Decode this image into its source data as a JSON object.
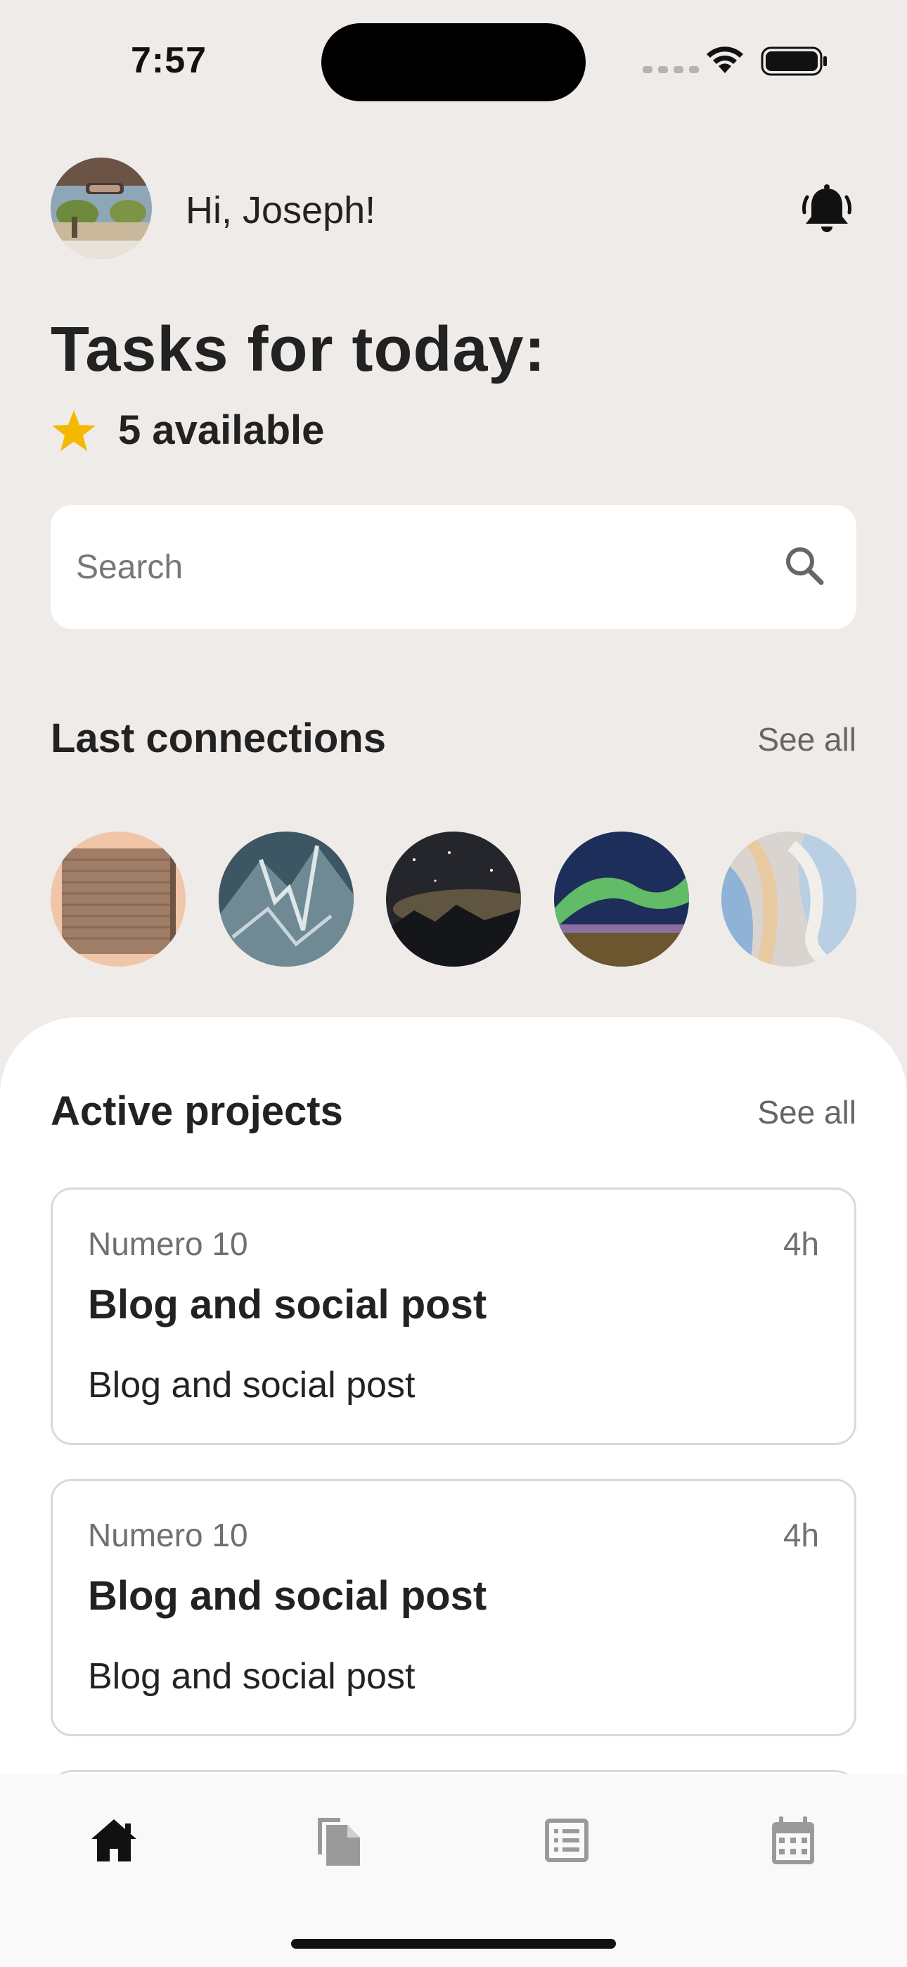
{
  "status_bar": {
    "time": "7:57"
  },
  "header": {
    "greeting": "Hi, Joseph!"
  },
  "tasks": {
    "title": "Tasks for today:",
    "available": "5 available"
  },
  "search": {
    "placeholder": "Search"
  },
  "connections": {
    "title": "Last connections",
    "see_all": "See all",
    "items": [
      "garage-door",
      "snowy-mountain",
      "milky-way",
      "aurora",
      "abstract-waves"
    ]
  },
  "projects": {
    "title": "Active projects",
    "see_all": "See all",
    "items": [
      {
        "client": "Numero 10",
        "hours": "4h",
        "name": "Blog and social post",
        "description": "Blog and social post"
      },
      {
        "client": "Numero 10",
        "hours": "4h",
        "name": "Blog and social post",
        "description": "Blog and social post"
      }
    ]
  },
  "tabbar": {
    "items": [
      "home-icon",
      "documents-icon",
      "list-icon",
      "calendar-icon"
    ],
    "active": "home-icon"
  },
  "colors": {
    "background": "#efebe9",
    "star": "#f5b800",
    "card_border": "#d9d9d9",
    "tab_inactive": "#9a9a9a"
  }
}
